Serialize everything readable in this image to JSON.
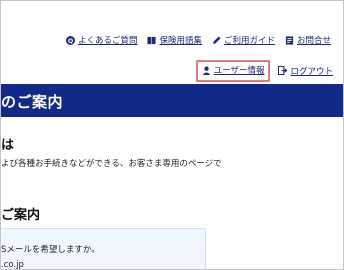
{
  "top_nav": {
    "faq": "よくあるご質問",
    "glossary": "保険用語集",
    "guide": "ご利用ガイド",
    "contact": "お問合せ"
  },
  "user_nav": {
    "user_info": "ユーザー情報",
    "logout": "ログアウト"
  },
  "banner": {
    "title": "のご案内"
  },
  "section1": {
    "title": "は",
    "text": "よび各種お手続きなどができる、お客さま専用のページで"
  },
  "section2": {
    "title": "ご案内",
    "line1": "Sメールを希望しますか。",
    "line2": ".co.jp"
  },
  "colors": {
    "banner": "#13298a",
    "link": "#1a2a7a",
    "highlight_border": "#e07b7b",
    "info_bg": "#eef7fe"
  }
}
